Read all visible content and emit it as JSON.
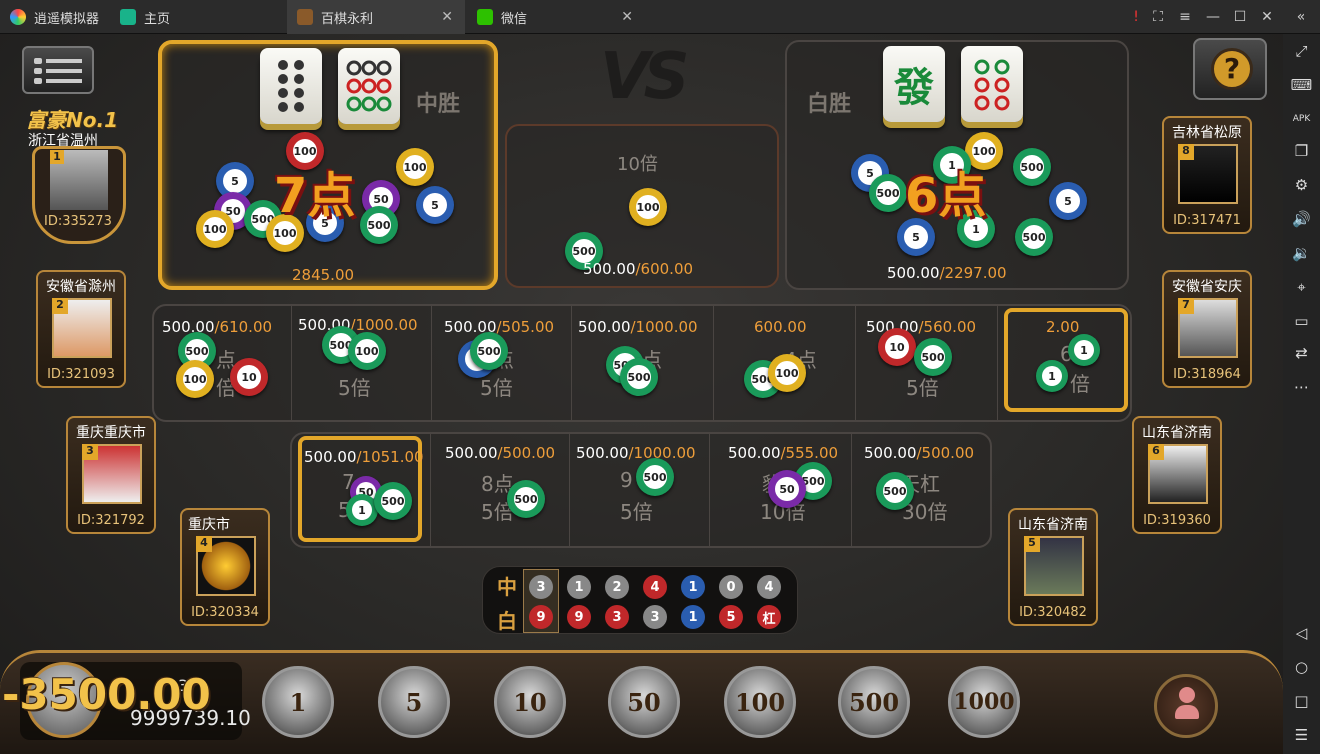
{
  "titlebar": {
    "app_name": "逍遥模拟器",
    "tabs": [
      {
        "label": "主页"
      },
      {
        "label": "百棋永利"
      },
      {
        "label": "微信"
      }
    ],
    "controls": [
      "!",
      "⛶",
      "≡",
      "—",
      "☐",
      "✕",
      "«"
    ]
  },
  "menu_icon": "menu-icon",
  "help_icon": "?",
  "vs_label": "VS",
  "zhong": {
    "label": "中胜",
    "tiles": [
      "eight-bamboo-dots",
      "nine-circle-dots"
    ],
    "points_text": "7点",
    "amount": "2845.00"
  },
  "tie": {
    "mult": "10倍",
    "amount_a": "500.00",
    "amount_b": "/600.00"
  },
  "bai": {
    "label": "白胜",
    "tiles": [
      "發",
      "circle-dots"
    ],
    "points_text": "6点",
    "amount_a": "500.00",
    "amount_b": "/2297.00"
  },
  "row1": [
    {
      "a": "500.00",
      "b": "/610.00",
      "line1": "点",
      "line2": "倍"
    },
    {
      "a": "500.00",
      "b": "/1000.00",
      "line1": "",
      "line2": "5倍"
    },
    {
      "a": "500.00",
      "b": "/505.00",
      "line1": "点",
      "line2": "5倍"
    },
    {
      "a": "500.00",
      "b": "/1000.00",
      "line1": "点",
      "line2": ""
    },
    {
      "a": "",
      "b": "600.00",
      "line1": "4点",
      "line2": ""
    },
    {
      "a": "500.00",
      "b": "/560.00",
      "line1": "",
      "line2": "5倍"
    },
    {
      "a": "",
      "b": "2.00",
      "line1": "6",
      "line2": "倍"
    }
  ],
  "row2": [
    {
      "a": "500.00",
      "b": "/1051.00",
      "line1": "7",
      "line2": "5"
    },
    {
      "a": "500.00",
      "b": "/500.00",
      "line1": "8点",
      "line2": "5倍"
    },
    {
      "a": "500.00",
      "b": "/1000.00",
      "line1": "9",
      "line2": "5倍"
    },
    {
      "a": "500.00",
      "b": "/555.00",
      "line1": "豹",
      "line2": "10倍"
    },
    {
      "a": "500.00",
      "b": "/500.00",
      "line1": "天杠",
      "line2": "30倍"
    }
  ],
  "players": [
    {
      "title": "富豪No.1",
      "loc": "浙江省温州",
      "seat": "1",
      "id": "ID:335273"
    },
    {
      "loc": "安徽省滁州",
      "seat": "2",
      "id": "ID:321093"
    },
    {
      "loc": "重庆重庆市",
      "seat": "3",
      "id": "ID:321792"
    },
    {
      "loc": "重庆市",
      "seat": "4",
      "id": "ID:320334"
    },
    {
      "loc": "山东省济南",
      "seat": "5",
      "id": "ID:320482"
    },
    {
      "loc": "山东省济南",
      "seat": "6",
      "id": "ID:319360"
    },
    {
      "loc": "安徽省安庆",
      "seat": "7",
      "id": "ID:318964"
    },
    {
      "loc": "吉林省松原",
      "seat": "8",
      "id": "ID:317471"
    }
  ],
  "history": {
    "zhong_label": "中",
    "bai_label": "白",
    "zhong": [
      "3",
      "1",
      "2",
      "4",
      "1",
      "0",
      "4"
    ],
    "bai": [
      "9",
      "9",
      "3",
      "3",
      "1",
      "5",
      "杠"
    ]
  },
  "me": {
    "id_partial": "3",
    "balance": "9999739.10",
    "delta": "-3500.00"
  },
  "bet_chips": [
    "1",
    "5",
    "10",
    "50",
    "100",
    "500",
    "1000"
  ],
  "colors": {
    "gold": "#e3a72a",
    "red_chip": "#c0282a",
    "blue_chip": "#2a5db0",
    "green_chip": "#1a9a5a"
  }
}
